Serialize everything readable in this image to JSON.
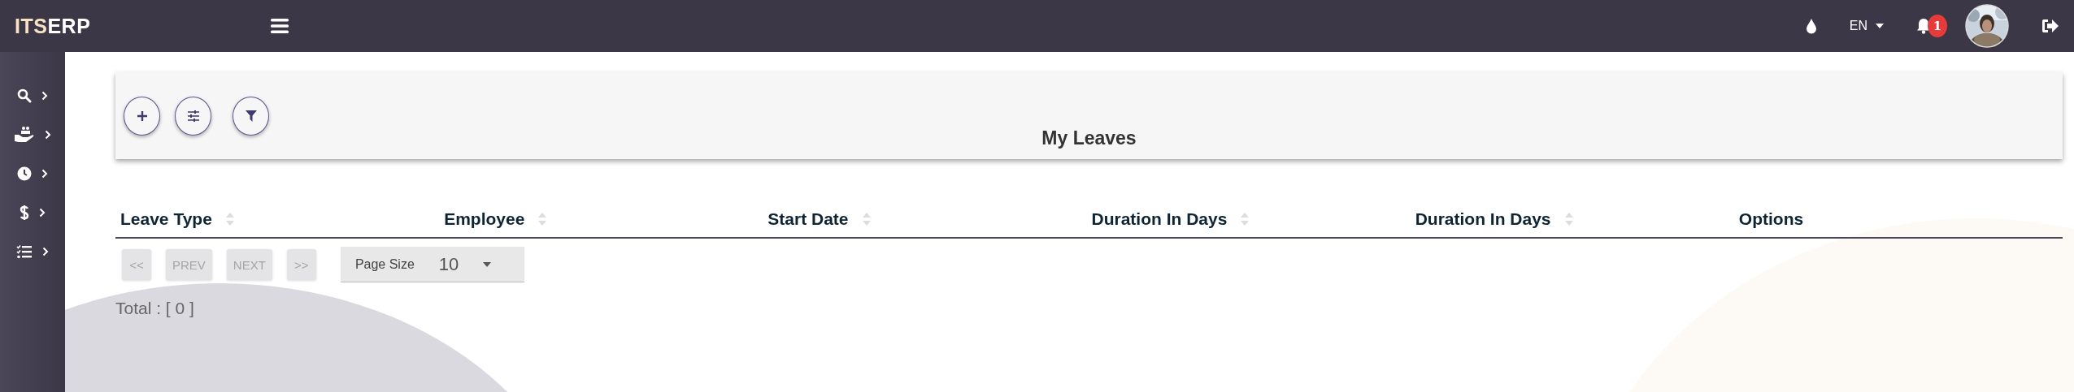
{
  "topbar": {
    "logo_prefix": "ITS",
    "logo_suffix": "ERP",
    "language": "EN",
    "notification_count": "1"
  },
  "sidebar": {
    "items": [
      {
        "kind": "search"
      },
      {
        "kind": "people"
      },
      {
        "kind": "clock"
      },
      {
        "kind": "dollar"
      },
      {
        "kind": "list"
      }
    ]
  },
  "toolbar": {
    "title": "My Leaves",
    "buttons": [
      {
        "kind": "add"
      },
      {
        "kind": "sliders"
      },
      {
        "kind": "filter"
      }
    ]
  },
  "table": {
    "columns": [
      {
        "label": "Leave Type",
        "sortable": true
      },
      {
        "label": "Employee",
        "sortable": true
      },
      {
        "label": "Start Date",
        "sortable": true
      },
      {
        "label": "Duration In Days",
        "sortable": true
      },
      {
        "label": "Duration In Days",
        "sortable": true
      },
      {
        "label": "Options",
        "sortable": false
      }
    ]
  },
  "pagination": {
    "buttons": [
      "<<",
      "PREV",
      "NEXT",
      ">>"
    ],
    "page_size_label": "Page Size",
    "page_size": "10",
    "total": "Total : [ 0 ]"
  }
}
